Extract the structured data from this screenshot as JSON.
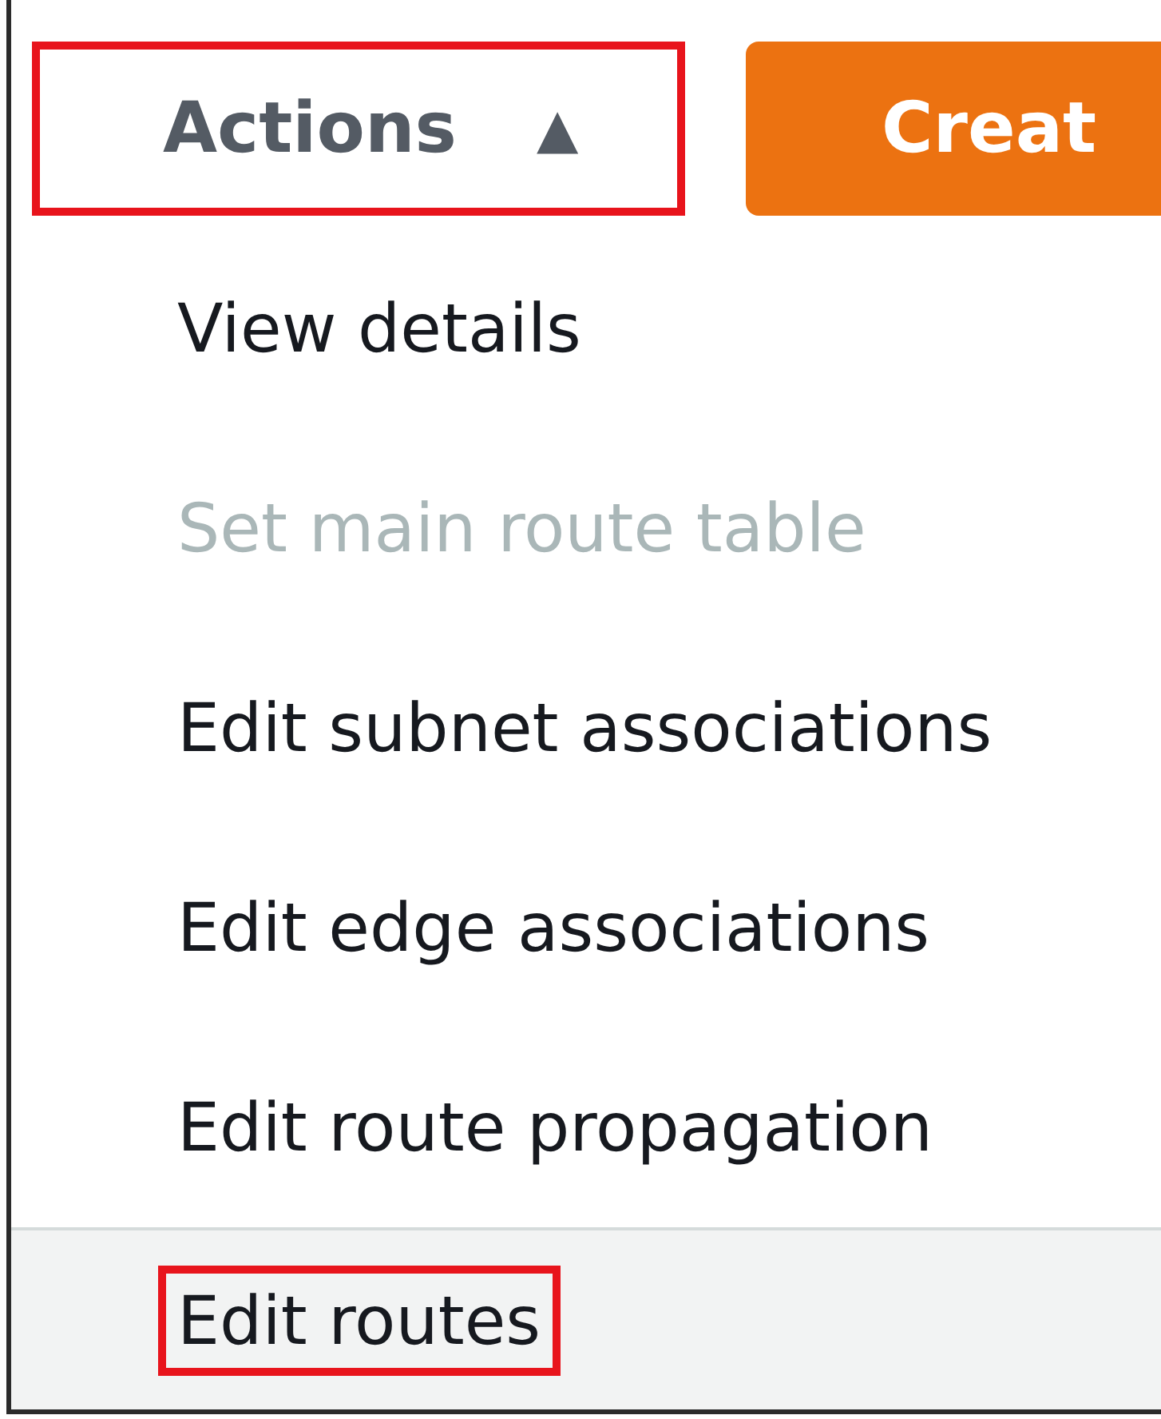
{
  "actions_button": {
    "label": "Actions",
    "caret": "▲",
    "expanded": true,
    "annotated": true
  },
  "create_button": {
    "label": "Creat"
  },
  "menu": [
    {
      "label": "View details",
      "disabled": false,
      "highlighted": false,
      "annotated": false
    },
    {
      "label": "Set main route table",
      "disabled": true,
      "highlighted": false,
      "annotated": false
    },
    {
      "label": "Edit subnet associations",
      "disabled": false,
      "highlighted": false,
      "annotated": false
    },
    {
      "label": "Edit edge associations",
      "disabled": false,
      "highlighted": false,
      "annotated": false
    },
    {
      "label": "Edit route propagation",
      "disabled": false,
      "highlighted": false,
      "annotated": false
    },
    {
      "label": "Edit routes",
      "disabled": false,
      "highlighted": true,
      "annotated": true
    }
  ]
}
